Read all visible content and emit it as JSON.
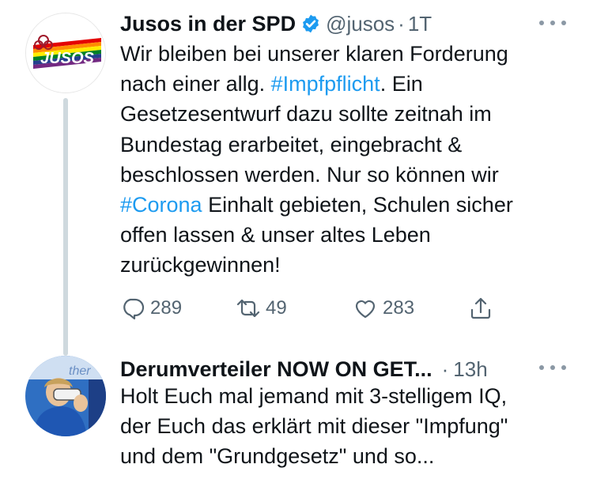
{
  "tweets": [
    {
      "name": "Jusos in der SPD",
      "handle": "@jusos",
      "separator": "·",
      "time": "1T",
      "logo_text": "JUSOS",
      "text_lines": [
        [
          {
            "t": "Wir bleiben bei unserer klaren Forderung",
            "tag": false
          }
        ],
        [
          {
            "t": "nach einer allg. ",
            "tag": false
          },
          {
            "t": "#Impfpflicht",
            "tag": true
          },
          {
            "t": ". Ein",
            "tag": false
          }
        ],
        [
          {
            "t": "Gesetzesentwurf dazu sollte zeitnah im",
            "tag": false
          }
        ],
        [
          {
            "t": "Bundestag erarbeitet, eingebracht &",
            "tag": false
          }
        ],
        [
          {
            "t": "beschlossen werden. Nur so können wir",
            "tag": false
          }
        ],
        [
          {
            "t": "#Corona",
            "tag": true
          },
          {
            "t": " Einhalt gebieten, Schulen sicher",
            "tag": false
          }
        ],
        [
          {
            "t": "offen lassen & unser altes Leben",
            "tag": false
          }
        ],
        [
          {
            "t": "zurückgewinnen!",
            "tag": false
          }
        ]
      ],
      "replies": "289",
      "retweets": "49",
      "likes": "283"
    },
    {
      "name": "Derumverteiler NOW ON GET...",
      "separator": "·",
      "time": "13h",
      "text_lines": [
        [
          {
            "t": "Holt Euch mal jemand mit 3-stelligem IQ,",
            "tag": false
          }
        ],
        [
          {
            "t": "der Euch das erklärt mit dieser \"Impfung\"",
            "tag": false
          }
        ],
        [
          {
            "t": "und dem \"Grundgesetz\" und so...",
            "tag": false
          }
        ]
      ]
    }
  ],
  "colors": {
    "hashtag": "#1d9bf0",
    "secondary_text": "#536471",
    "verified": "#1d9bf0",
    "thread_line": "#cfd9de"
  },
  "icons": [
    "verified-badge-icon",
    "more-icon",
    "reply-icon",
    "retweet-icon",
    "like-icon",
    "share-icon"
  ]
}
